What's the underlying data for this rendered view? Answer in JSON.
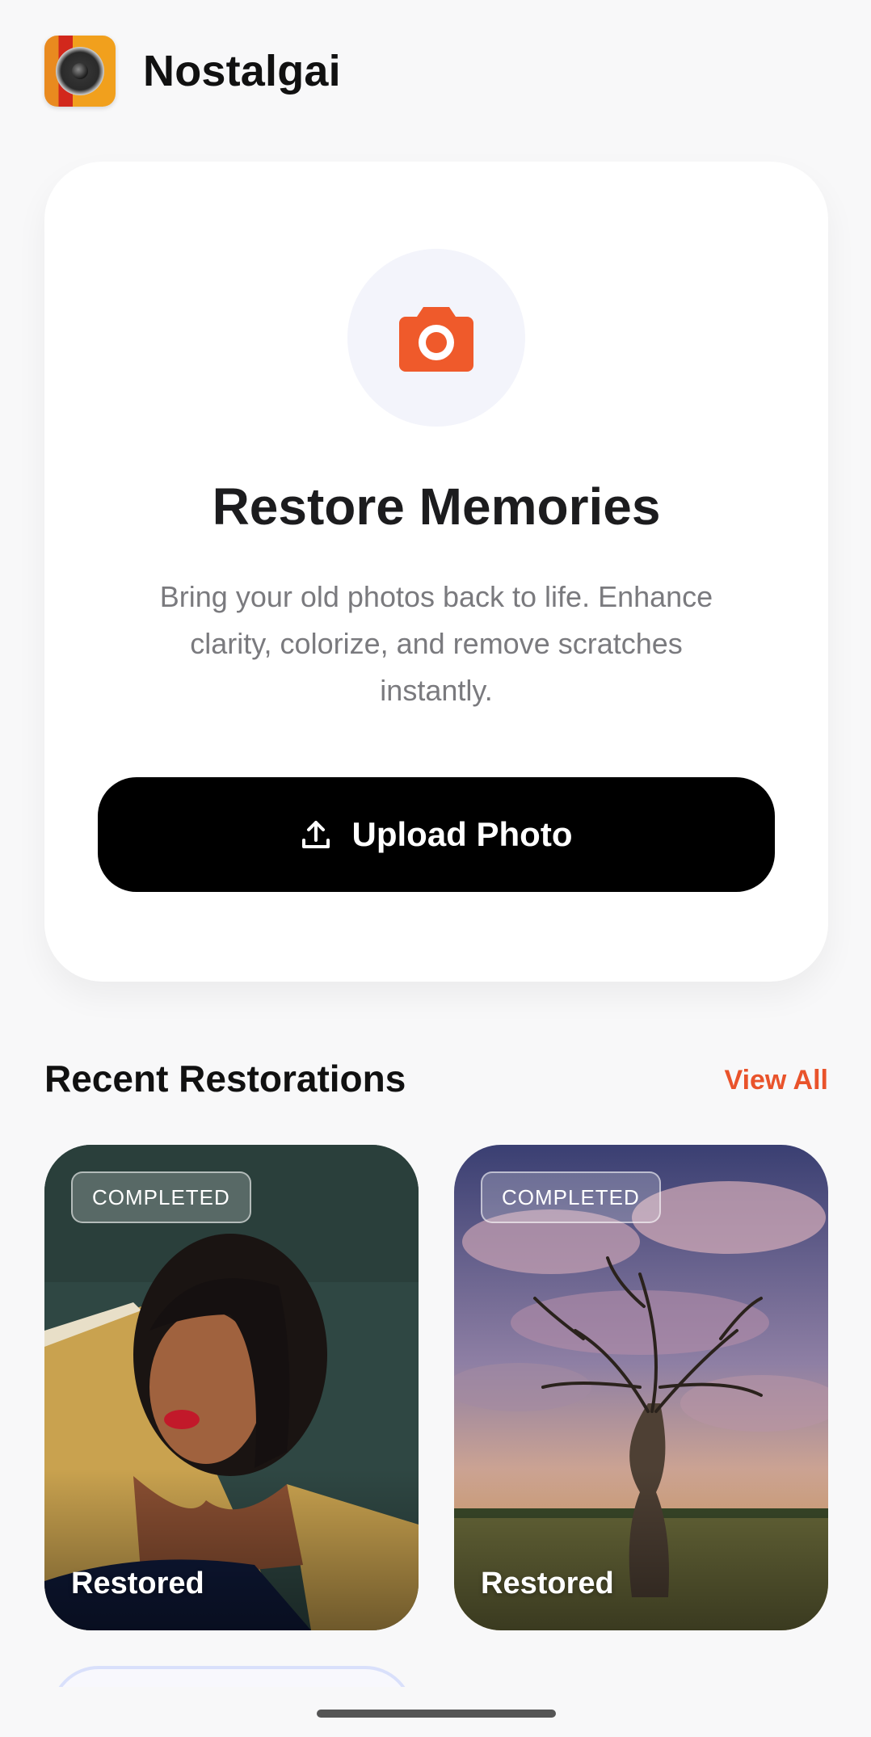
{
  "app": {
    "name": "Nostalgai",
    "accent_color": "#e9532b"
  },
  "hero": {
    "icon": "camera-icon",
    "title": "Restore Memories",
    "description": "Bring your old photos back to life. Enhance clarity, colorize, and remove scratches instantly.",
    "upload_button": {
      "label": "Upload Photo",
      "icon": "upload-icon"
    }
  },
  "recent": {
    "title": "Recent Restorations",
    "view_all_label": "View All",
    "items": [
      {
        "status": "COMPLETED",
        "label": "Restored",
        "image": "portrait-photo"
      },
      {
        "status": "COMPLETED",
        "label": "Restored",
        "image": "tree-sunset-photo"
      }
    ]
  }
}
